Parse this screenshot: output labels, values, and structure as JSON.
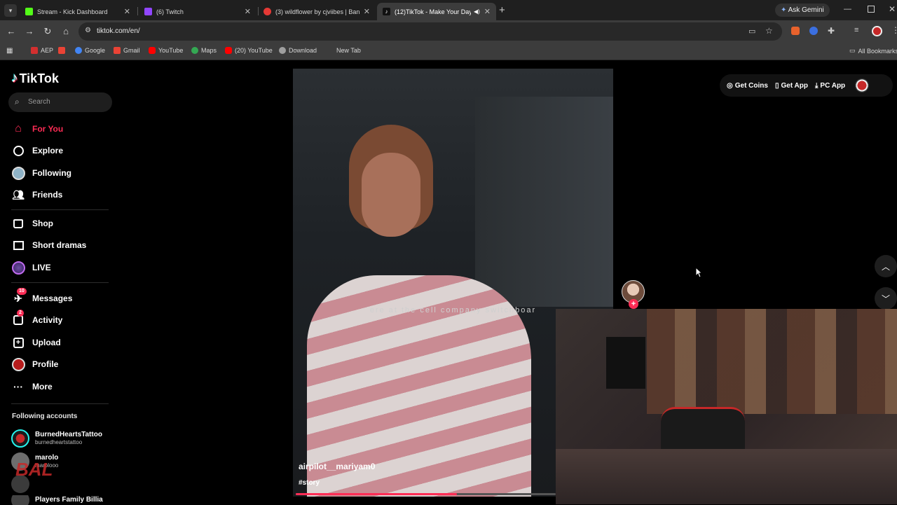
{
  "browser": {
    "tabs": [
      {
        "title": "Stream - Kick Dashboard",
        "favicon_color": "#53fc18",
        "active": false
      },
      {
        "title": "(6) Twitch",
        "favicon_color": "#9146ff",
        "active": false
      },
      {
        "title": "(3) wildflower by cjviibes | Band",
        "favicon_color": "#e53935",
        "active": false
      },
      {
        "title": "(12)TikTok - Make Your Day",
        "favicon_color": "#111111",
        "active": true
      }
    ],
    "ask_gemini": "Ask Gemini",
    "url": "tiktok.com/en/",
    "bookmarks": [
      {
        "label": "AEP",
        "color": "#d32f2f"
      },
      {
        "label": "",
        "color": "#ea4335"
      },
      {
        "label": "Google",
        "color": "#4285f4"
      },
      {
        "label": "Gmail",
        "color": "#ea4335"
      },
      {
        "label": "YouTube",
        "color": "#ff0000"
      },
      {
        "label": "Maps",
        "color": "#34a853"
      },
      {
        "label": "(20) YouTube",
        "color": "#ff0000"
      },
      {
        "label": "Download",
        "color": "#9e9e9e"
      },
      {
        "label": "New Tab",
        "color": ""
      }
    ],
    "all_bookmarks": "All Bookmarks"
  },
  "sidebar": {
    "logo": "TikTok",
    "search_placeholder": "Search",
    "nav": [
      {
        "label": "For You",
        "icon": "home-icon",
        "active": true
      },
      {
        "label": "Explore",
        "icon": "compass-icon"
      },
      {
        "label": "Following",
        "icon": "following-avatar-icon"
      },
      {
        "label": "Friends",
        "icon": "friends-icon"
      },
      {
        "label": "Shop",
        "icon": "shop-bag-icon"
      },
      {
        "label": "Short dramas",
        "icon": "film-icon"
      },
      {
        "label": "LIVE",
        "icon": "live-icon"
      },
      {
        "label": "Messages",
        "icon": "messages-icon",
        "badge": "10"
      },
      {
        "label": "Activity",
        "icon": "activity-icon",
        "badge": "2"
      },
      {
        "label": "Upload",
        "icon": "upload-icon"
      },
      {
        "label": "Profile",
        "icon": "profile-avatar-icon"
      },
      {
        "label": "More",
        "icon": "more-icon"
      }
    ],
    "following_title": "Following accounts",
    "accounts": [
      {
        "name": "BurnedHeartsTattoo",
        "handle": "burnedheartstattoo"
      },
      {
        "name": "marolo",
        "handle": "marolooo"
      },
      {
        "name": "",
        "handle": ""
      },
      {
        "name": "Players Family Billia",
        "handle": ""
      }
    ]
  },
  "topbar": {
    "get_coins": "Get Coins",
    "get_app": "Get App",
    "pc_app": "PC App"
  },
  "video": {
    "caption": "ere at the cell company switchboar",
    "username": "airpilot__mariyam0",
    "hashtag": "#story",
    "progress": 0.62
  },
  "colors": {
    "accent": "#fe2c55",
    "background": "#000000"
  }
}
